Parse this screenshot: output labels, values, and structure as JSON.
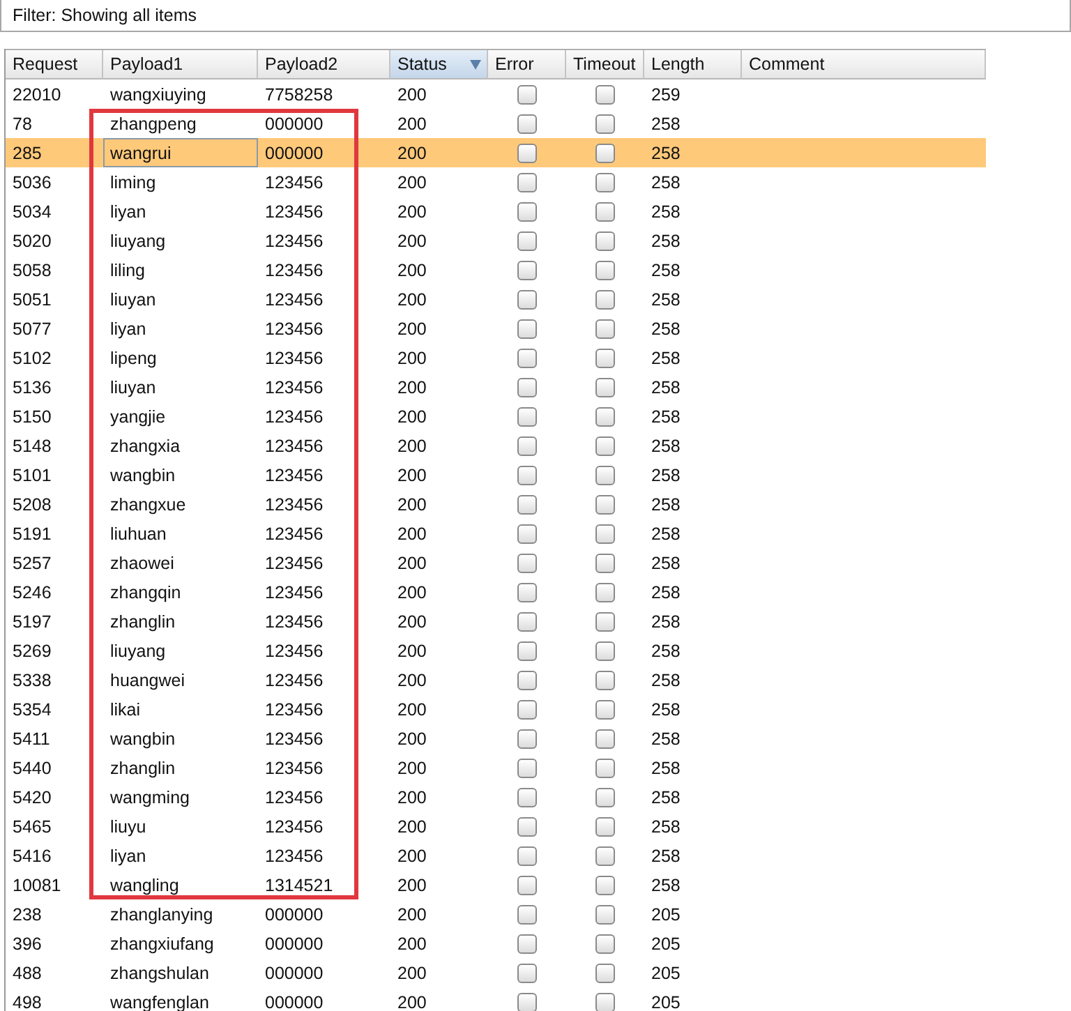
{
  "filter": {
    "label": "Filter: Showing all items"
  },
  "columns": [
    {
      "label": "Request",
      "sorted": false
    },
    {
      "label": "Payload1",
      "sorted": false
    },
    {
      "label": "Payload2",
      "sorted": false
    },
    {
      "label": "Status",
      "sorted": true
    },
    {
      "label": "Error",
      "sorted": false
    },
    {
      "label": "Timeout",
      "sorted": false
    },
    {
      "label": "Length",
      "sorted": false
    },
    {
      "label": "Comment",
      "sorted": false
    }
  ],
  "row_groups": [
    {
      "rows": [
        {
          "request": "22010",
          "payload1": "wangxiuying",
          "payload2": "7758258",
          "status": "200",
          "error": false,
          "timeout": false,
          "length": "259",
          "selected": false
        }
      ]
    },
    {
      "framed": true,
      "rows": [
        {
          "request": "78",
          "payload1": "zhangpeng",
          "payload2": "000000",
          "status": "200",
          "error": false,
          "timeout": false,
          "length": "258",
          "selected": false
        },
        {
          "request": "285",
          "payload1": "wangrui",
          "payload2": "000000",
          "status": "200",
          "error": false,
          "timeout": false,
          "length": "258",
          "selected": true
        },
        {
          "request": "5036",
          "payload1": "liming",
          "payload2": "123456",
          "status": "200",
          "error": false,
          "timeout": false,
          "length": "258",
          "selected": false
        },
        {
          "request": "5034",
          "payload1": "liyan",
          "payload2": "123456",
          "status": "200",
          "error": false,
          "timeout": false,
          "length": "258",
          "selected": false
        },
        {
          "request": "5020",
          "payload1": "liuyang",
          "payload2": "123456",
          "status": "200",
          "error": false,
          "timeout": false,
          "length": "258",
          "selected": false
        },
        {
          "request": "5058",
          "payload1": "liling",
          "payload2": "123456",
          "status": "200",
          "error": false,
          "timeout": false,
          "length": "258",
          "selected": false
        },
        {
          "request": "5051",
          "payload1": "liuyan",
          "payload2": "123456",
          "status": "200",
          "error": false,
          "timeout": false,
          "length": "258",
          "selected": false
        },
        {
          "request": "5077",
          "payload1": "liyan",
          "payload2": "123456",
          "status": "200",
          "error": false,
          "timeout": false,
          "length": "258",
          "selected": false
        },
        {
          "request": "5102",
          "payload1": "lipeng",
          "payload2": "123456",
          "status": "200",
          "error": false,
          "timeout": false,
          "length": "258",
          "selected": false
        },
        {
          "request": "5136",
          "payload1": "liuyan",
          "payload2": "123456",
          "status": "200",
          "error": false,
          "timeout": false,
          "length": "258",
          "selected": false
        },
        {
          "request": "5150",
          "payload1": "yangjie",
          "payload2": "123456",
          "status": "200",
          "error": false,
          "timeout": false,
          "length": "258",
          "selected": false
        },
        {
          "request": "5148",
          "payload1": "zhangxia",
          "payload2": "123456",
          "status": "200",
          "error": false,
          "timeout": false,
          "length": "258",
          "selected": false
        },
        {
          "request": "5101",
          "payload1": "wangbin",
          "payload2": "123456",
          "status": "200",
          "error": false,
          "timeout": false,
          "length": "258",
          "selected": false
        },
        {
          "request": "5208",
          "payload1": "zhangxue",
          "payload2": "123456",
          "status": "200",
          "error": false,
          "timeout": false,
          "length": "258",
          "selected": false
        },
        {
          "request": "5191",
          "payload1": "liuhuan",
          "payload2": "123456",
          "status": "200",
          "error": false,
          "timeout": false,
          "length": "258",
          "selected": false
        },
        {
          "request": "5257",
          "payload1": "zhaowei",
          "payload2": "123456",
          "status": "200",
          "error": false,
          "timeout": false,
          "length": "258",
          "selected": false
        },
        {
          "request": "5246",
          "payload1": "zhangqin",
          "payload2": "123456",
          "status": "200",
          "error": false,
          "timeout": false,
          "length": "258",
          "selected": false
        },
        {
          "request": "5197",
          "payload1": "zhanglin",
          "payload2": "123456",
          "status": "200",
          "error": false,
          "timeout": false,
          "length": "258",
          "selected": false
        },
        {
          "request": "5269",
          "payload1": "liuyang",
          "payload2": "123456",
          "status": "200",
          "error": false,
          "timeout": false,
          "length": "258",
          "selected": false
        },
        {
          "request": "5338",
          "payload1": "huangwei",
          "payload2": "123456",
          "status": "200",
          "error": false,
          "timeout": false,
          "length": "258",
          "selected": false
        },
        {
          "request": "5354",
          "payload1": "likai",
          "payload2": "123456",
          "status": "200",
          "error": false,
          "timeout": false,
          "length": "258",
          "selected": false
        },
        {
          "request": "5411",
          "payload1": "wangbin",
          "payload2": "123456",
          "status": "200",
          "error": false,
          "timeout": false,
          "length": "258",
          "selected": false
        },
        {
          "request": "5440",
          "payload1": "zhanglin",
          "payload2": "123456",
          "status": "200",
          "error": false,
          "timeout": false,
          "length": "258",
          "selected": false
        },
        {
          "request": "5420",
          "payload1": "wangming",
          "payload2": "123456",
          "status": "200",
          "error": false,
          "timeout": false,
          "length": "258",
          "selected": false
        },
        {
          "request": "5465",
          "payload1": "liuyu",
          "payload2": "123456",
          "status": "200",
          "error": false,
          "timeout": false,
          "length": "258",
          "selected": false
        },
        {
          "request": "5416",
          "payload1": "liyan",
          "payload2": "123456",
          "status": "200",
          "error": false,
          "timeout": false,
          "length": "258",
          "selected": false
        },
        {
          "request": "10081",
          "payload1": "wangling",
          "payload2": "1314521",
          "status": "200",
          "error": false,
          "timeout": false,
          "length": "258",
          "selected": false
        }
      ]
    },
    {
      "rows": [
        {
          "request": "238",
          "payload1": "zhanglanying",
          "payload2": "000000",
          "status": "200",
          "error": false,
          "timeout": false,
          "length": "205",
          "selected": false
        },
        {
          "request": "396",
          "payload1": "zhangxiufang",
          "payload2": "000000",
          "status": "200",
          "error": false,
          "timeout": false,
          "length": "205",
          "selected": false
        },
        {
          "request": "488",
          "payload1": "zhangshulan",
          "payload2": "000000",
          "status": "200",
          "error": false,
          "timeout": false,
          "length": "205",
          "selected": false
        },
        {
          "request": "498",
          "payload1": "wangfenglan",
          "payload2": "000000",
          "status": "200",
          "error": false,
          "timeout": false,
          "length": "205",
          "selected": false
        }
      ]
    }
  ]
}
